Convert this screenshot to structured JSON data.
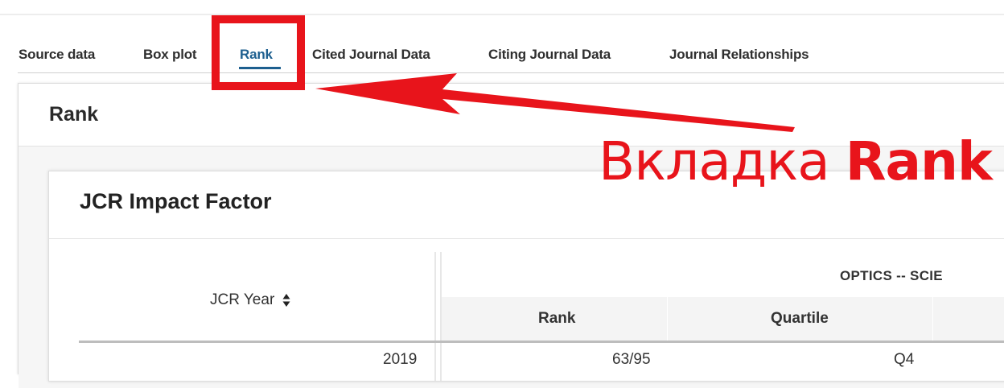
{
  "tabs": [
    {
      "label": "Source data"
    },
    {
      "label": "Box plot"
    },
    {
      "label": "Rank"
    },
    {
      "label": "Cited Journal Data"
    },
    {
      "label": "Citing Journal Data"
    },
    {
      "label": "Journal Relationships"
    }
  ],
  "active_tab": "Rank",
  "panel": {
    "title": "Rank"
  },
  "card": {
    "title": "JCR Impact Factor",
    "table": {
      "year_header": "JCR Year",
      "group_header": "OPTICS -- SCIE",
      "subheaders": [
        "Rank",
        "Quartile"
      ],
      "first_row_partial": [
        "2019",
        "63/95",
        "Q4"
      ]
    }
  },
  "annotation": {
    "text_regular": "Вкладка",
    "text_bold": "Rank",
    "color": "#e8141b"
  },
  "colors": {
    "accent": "#1d5f8f",
    "annotation": "#e8141b"
  }
}
